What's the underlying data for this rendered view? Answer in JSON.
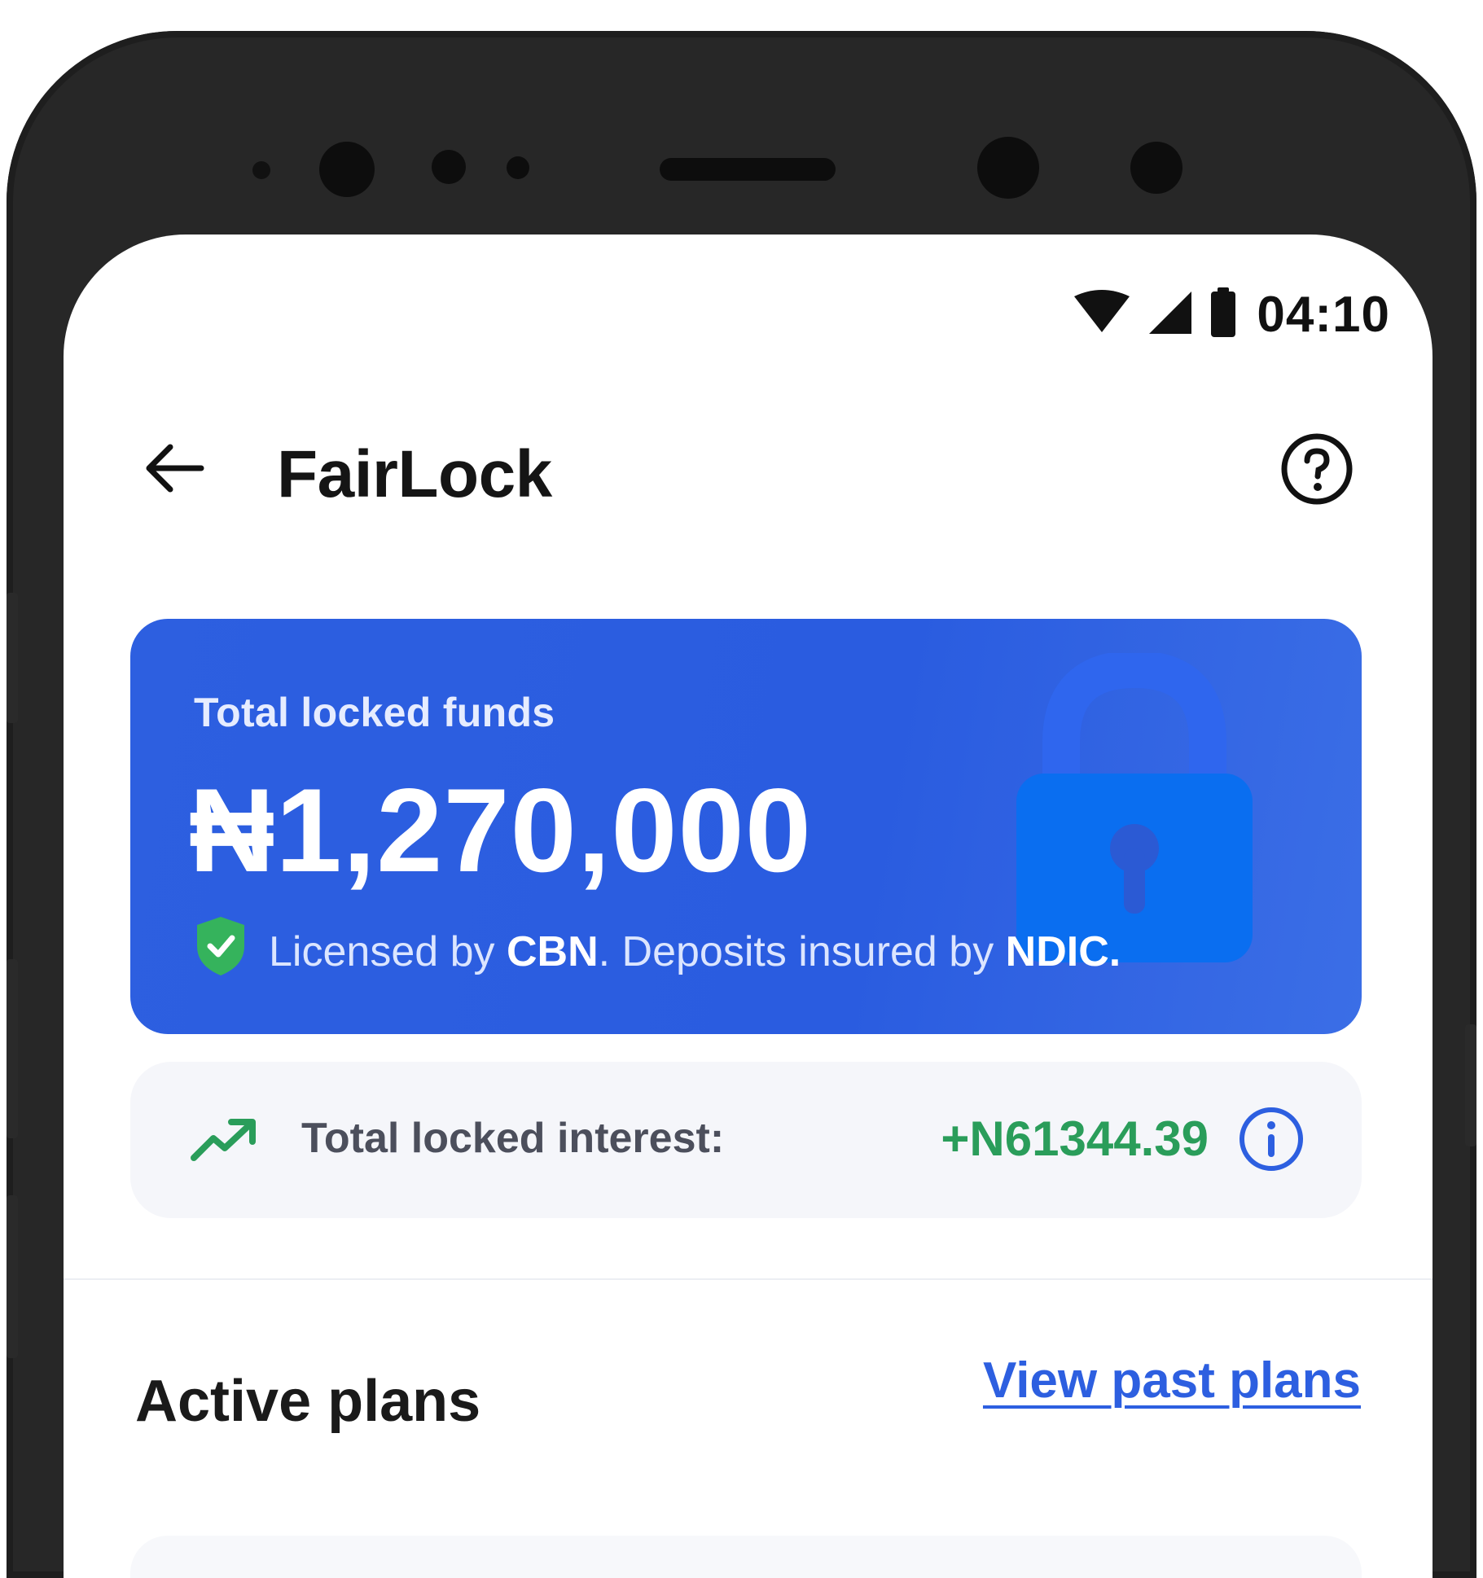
{
  "status_bar": {
    "time": "04:10",
    "icons": [
      "wifi-icon",
      "signal-icon",
      "battery-icon"
    ]
  },
  "app_bar": {
    "title": "FairLock",
    "back_icon": "arrow-left-icon",
    "help_icon": "help-circle-icon"
  },
  "balance_card": {
    "label": "Total locked funds",
    "amount": "₦1,270,000",
    "license_prefix": "Licensed by ",
    "license_regulator": "CBN",
    "license_middle": ". Deposits insured by ",
    "license_insurer": "NDIC",
    "license_suffix": ".",
    "badge_icon": "shield-check-icon",
    "background_icon": "padlock-icon"
  },
  "interest": {
    "label": "Total locked interest:",
    "value": "+N61344.39",
    "trend_icon": "trend-up-icon",
    "info_icon": "info-icon"
  },
  "active_plans": {
    "title": "Active plans",
    "view_past_label": "View past plans"
  },
  "colors": {
    "primary": "#2d5fe0",
    "positive": "#2a9d5a",
    "card_lock": "#0a6ef0",
    "phone_frame": "#272727"
  }
}
